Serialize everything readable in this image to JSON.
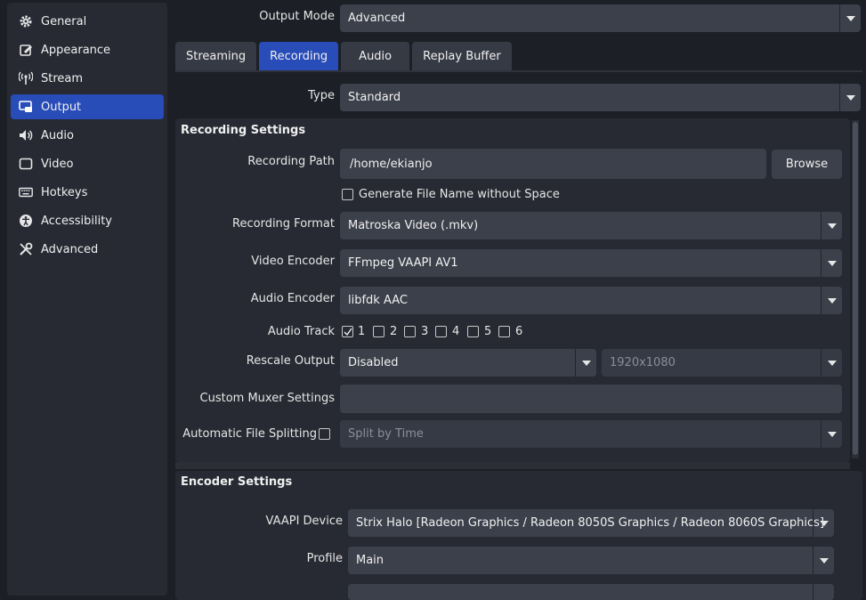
{
  "sidebar": {
    "items": [
      {
        "label": "General",
        "icon": "gear-icon"
      },
      {
        "label": "Appearance",
        "icon": "palette-icon"
      },
      {
        "label": "Stream",
        "icon": "broadcast-icon"
      },
      {
        "label": "Output",
        "icon": "output-icon"
      },
      {
        "label": "Audio",
        "icon": "speaker-icon"
      },
      {
        "label": "Video",
        "icon": "monitor-icon"
      },
      {
        "label": "Hotkeys",
        "icon": "keyboard-icon"
      },
      {
        "label": "Accessibility",
        "icon": "accessibility-icon"
      },
      {
        "label": "Advanced",
        "icon": "wrench-icon"
      }
    ],
    "active": "Output"
  },
  "output_mode": {
    "label": "Output Mode",
    "value": "Advanced"
  },
  "tabs": [
    {
      "label": "Streaming"
    },
    {
      "label": "Recording"
    },
    {
      "label": "Audio"
    },
    {
      "label": "Replay Buffer"
    }
  ],
  "active_tab": "Recording",
  "type": {
    "label": "Type",
    "value": "Standard"
  },
  "recording": {
    "title": "Recording Settings",
    "path_label": "Recording Path",
    "path_value": "/home/ekianjo",
    "browse_label": "Browse",
    "gen_filename_label": "Generate File Name without Space",
    "gen_filename_checked": false,
    "format_label": "Recording Format",
    "format_value": "Matroska Video (.mkv)",
    "video_encoder_label": "Video Encoder",
    "video_encoder_value": "FFmpeg VAAPI AV1",
    "audio_encoder_label": "Audio Encoder",
    "audio_encoder_value": "libfdk AAC",
    "audio_track_label": "Audio Track",
    "audio_tracks": [
      {
        "label": "1",
        "checked": true
      },
      {
        "label": "2",
        "checked": false
      },
      {
        "label": "3",
        "checked": false
      },
      {
        "label": "4",
        "checked": false
      },
      {
        "label": "5",
        "checked": false
      },
      {
        "label": "6",
        "checked": false
      }
    ],
    "rescale_label": "Rescale Output",
    "rescale_value": "Disabled",
    "rescale_resolution": "1920x1080",
    "muxer_label": "Custom Muxer Settings",
    "muxer_value": "",
    "split_label": "Automatic File Splitting",
    "split_checked": false,
    "split_value": "Split by Time"
  },
  "encoder": {
    "title": "Encoder Settings",
    "device_label": "VAAPI Device",
    "device_value": "Strix Halo [Radeon Graphics / Radeon 8050S Graphics / Radeon 8060S Graphics]",
    "profile_label": "Profile",
    "profile_value": "Main"
  },
  "colors": {
    "background": "#1d1f26",
    "panel": "#272a33",
    "accent": "#284cb8",
    "control": "#3c404b"
  }
}
